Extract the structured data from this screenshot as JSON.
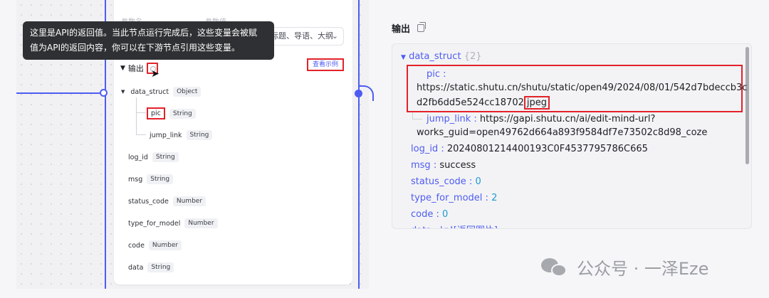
{
  "tooltip": {
    "line1": "这里是API的返回值。当此节点运行完成后，这些变量会被赋",
    "line2": "值为API的返回内容，你可以在下游节点引用这些变量。"
  },
  "params": {
    "col_name": "参数名",
    "col_value": "参数值",
    "select_value": "标题、导语、大纲"
  },
  "output": {
    "title": "输出",
    "example_link": "查看示例",
    "fields": [
      {
        "name": "data_struct",
        "type": "Object"
      },
      {
        "name": "pic",
        "type": "String"
      },
      {
        "name": "jump_link",
        "type": "String"
      },
      {
        "name": "log_id",
        "type": "String"
      },
      {
        "name": "msg",
        "type": "String"
      },
      {
        "name": "status_code",
        "type": "Number"
      },
      {
        "name": "type_for_model",
        "type": "Number"
      },
      {
        "name": "code",
        "type": "Number"
      },
      {
        "name": "data",
        "type": "String"
      }
    ]
  },
  "result": {
    "title": "输出",
    "data_struct_key": "data_struct",
    "data_struct_count": "{2}",
    "pic_key": "pic :",
    "pic_url_1": "https://static.shutu.cn/shutu/static/open49/2024/08/01/542d7bdeccb3c",
    "pic_url_2": "d2fb6dd5e524cc18702",
    "pic_ext": "jpeg",
    "jump_key": "jump_link :",
    "jump_url_1": "https://gapi.shutu.cn/ai/edit-mind-url?",
    "jump_url_2": "works_guid=open49762d664a893f9584df7e73502c8d98_coze",
    "log_key": "log_id :",
    "log_val": "20240801214400193C0F4537795786C665",
    "msg_key": "msg :",
    "msg_val": "success",
    "status_key": "status_code :",
    "status_val": "0",
    "type_key": "type_for_model :",
    "type_val": "2",
    "code_key": "code :",
    "code_val": "0",
    "data_partial": "data : \\n![返回图片]"
  },
  "watermark": {
    "text": "公众号 · 一泽Eze"
  },
  "colors": {
    "accent": "#4e5cf2",
    "highlight": "#e2222a",
    "tooltip_bg": "#2f3033",
    "number": "#1f9bd1"
  }
}
